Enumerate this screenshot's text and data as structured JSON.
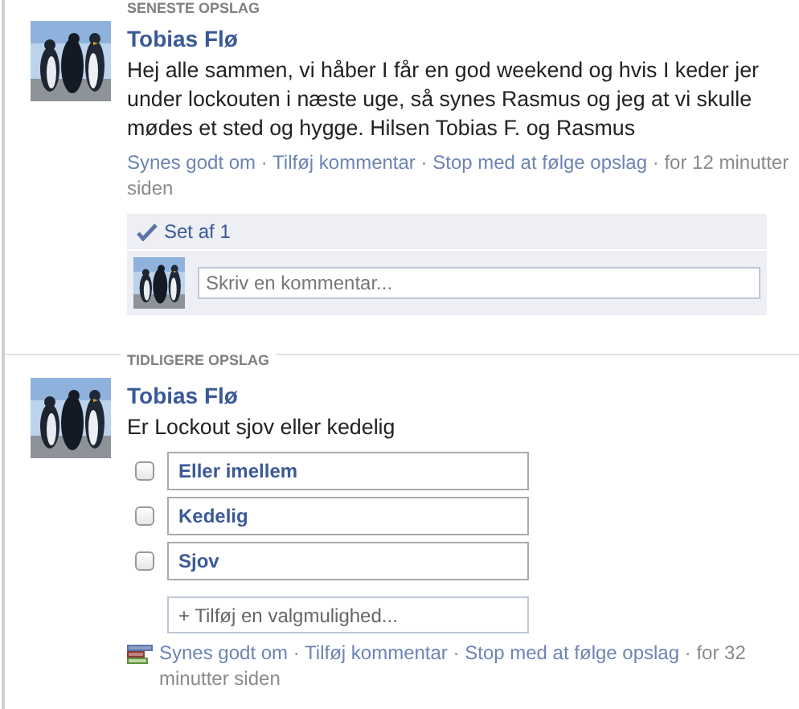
{
  "sections": [
    {
      "label": "SENESTE OPSLAG",
      "posts": [
        {
          "kind": "status",
          "author": "Tobias Flø",
          "text": "Hej alle sammen, vi håber I får en god weekend og hvis I keder jer under lockouten i næste uge, så synes Rasmus og jeg at vi skulle mødes et sted og hygge. Hilsen Tobias F. og Rasmus",
          "meta": [
            {
              "kind": "link",
              "text": "Synes godt om"
            },
            {
              "kind": "sep",
              "text": "·"
            },
            {
              "kind": "link",
              "text": "Tilføj kommentar"
            },
            {
              "kind": "sep",
              "text": "·"
            },
            {
              "kind": "link",
              "text": "Stop med at følge opslag"
            },
            {
              "kind": "sep",
              "text": "·"
            },
            {
              "kind": "time",
              "text": "for 12 minutter siden"
            }
          ],
          "seen_by": "Set af 1",
          "comment": {
            "placeholder": "Skriv en kommentar..."
          }
        }
      ]
    },
    {
      "label": "TIDLIGERE OPSLAG",
      "posts": [
        {
          "kind": "poll",
          "author": "Tobias Flø",
          "text": "Er Lockout sjov eller kedelig",
          "options": [
            {
              "label": "Eller imellem",
              "checked": false
            },
            {
              "label": "Kedelig",
              "checked": false
            },
            {
              "label": "Sjov",
              "checked": false
            }
          ],
          "add_option": {
            "placeholder": "+ Tilføj en valgmulighed..."
          },
          "meta": [
            {
              "kind": "link",
              "text": "Synes godt om"
            },
            {
              "kind": "sep",
              "text": "·"
            },
            {
              "kind": "link",
              "text": "Tilføj kommentar"
            },
            {
              "kind": "sep",
              "text": "·"
            },
            {
              "kind": "link",
              "text": "Stop med at følge opslag"
            },
            {
              "kind": "sep",
              "text": "·"
            },
            {
              "kind": "time",
              "text": "for 32 minutter siden"
            }
          ]
        }
      ]
    }
  ]
}
